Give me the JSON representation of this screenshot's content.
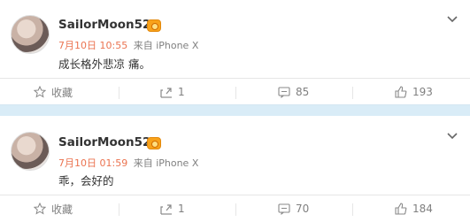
{
  "posts": [
    {
      "username": "SailorMoon523",
      "time": "7月10日 10:55",
      "source": "来自 iPhone X",
      "content": "成长格外悲凉 痛。",
      "actions": {
        "favorite": "收藏",
        "forward": "1",
        "comment": "85",
        "like": "193"
      }
    },
    {
      "username": "SailorMoon523",
      "time": "7月10日 01:59",
      "source": "来自 iPhone X",
      "content": "乖，会好的",
      "actions": {
        "favorite": "收藏",
        "forward": "1",
        "comment": "70",
        "like": "184"
      }
    }
  ],
  "icons": [
    "avatar",
    "vip-badge-icon",
    "chevron-down-icon",
    "star-icon",
    "forward-icon",
    "comment-icon",
    "thumbs-up-icon"
  ],
  "colors": {
    "time": "#eb7350",
    "text": "#333333",
    "muted": "#808080",
    "separator": "#d9ecf7"
  }
}
